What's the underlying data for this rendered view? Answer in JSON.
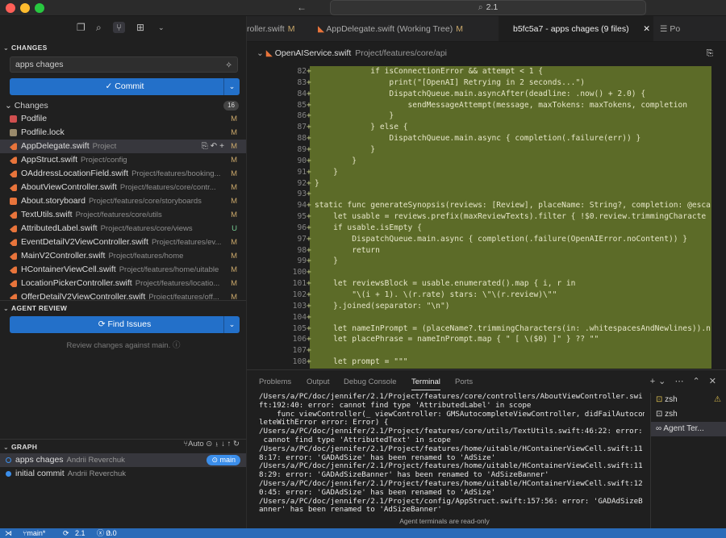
{
  "titlebar": {
    "search": "2.1"
  },
  "sidebar": {
    "changes_header": "CHANGES",
    "commit_message": "apps chages",
    "commit_label": "Commit",
    "changes_label": "Changes",
    "changes_count": "16",
    "files": [
      {
        "name": "Podfile",
        "path": "",
        "status": "M",
        "icon": "podfile-icon"
      },
      {
        "name": "Podfile.lock",
        "path": "",
        "status": "M",
        "icon": "lock-file-icon"
      },
      {
        "name": "AppDelegate.swift",
        "path": "Project",
        "status": "M",
        "icon": "swift-file-icon"
      },
      {
        "name": "AppStruct.swift",
        "path": "Project/config",
        "status": "M",
        "icon": "swift-file-icon"
      },
      {
        "name": "OAddressLocationField.swift",
        "path": "Project/features/booking...",
        "status": "M",
        "icon": "swift-file-icon"
      },
      {
        "name": "AboutViewController.swift",
        "path": "Project/features/core/contr...",
        "status": "M",
        "icon": "swift-file-icon"
      },
      {
        "name": "About.storyboard",
        "path": "Project/features/core/storyboards",
        "status": "M",
        "icon": "storyboard-icon"
      },
      {
        "name": "TextUtils.swift",
        "path": "Project/features/core/utils",
        "status": "M",
        "icon": "swift-file-icon"
      },
      {
        "name": "AttributedLabel.swift",
        "path": "Project/features/core/views",
        "status": "U",
        "icon": "swift-file-icon"
      },
      {
        "name": "EventDetailV2ViewController.swift",
        "path": "Project/features/ev...",
        "status": "M",
        "icon": "swift-file-icon"
      },
      {
        "name": "MainV2Controller.swift",
        "path": "Project/features/home",
        "status": "M",
        "icon": "swift-file-icon"
      },
      {
        "name": "HContainerViewCell.swift",
        "path": "Project/features/home/uitable",
        "status": "M",
        "icon": "swift-file-icon"
      },
      {
        "name": "LocationPickerController.swift",
        "path": "Project/features/locatio...",
        "status": "M",
        "icon": "swift-file-icon"
      },
      {
        "name": "OfferDetailV2ViewController.swift",
        "path": "Project/features/off...",
        "status": "M",
        "icon": "swift-file-icon"
      }
    ],
    "agent_review_header": "AGENT REVIEW",
    "find_issues_label": "Find Issues",
    "review_desc": "Review changes against main.",
    "graph_header": "GRAPH",
    "graph_auto": "Auto",
    "commits": [
      {
        "message": "apps chages",
        "author": "Andrii Reverchuk",
        "branch": "main"
      },
      {
        "message": "initial commit",
        "author": "Andrii Reverchuk",
        "branch": ""
      }
    ]
  },
  "tabs": [
    {
      "label": "roller.swift",
      "mark": "M"
    },
    {
      "label": "AppDelegate.swift (Working Tree)",
      "mark": "M"
    },
    {
      "label": "b5fc5a7 - apps chages (9 files)",
      "mark": ""
    },
    {
      "label": "Po",
      "mark": ""
    }
  ],
  "breadcrumb": {
    "file": "OpenAIService.swift",
    "path": "Project/features/core/api"
  },
  "code_lines": [
    {
      "n": "82",
      "t": "            if isConnectionError && attempt < 1 {"
    },
    {
      "n": "83",
      "t": "                print(\"[OpenAI] Retrying in 2 seconds...\")"
    },
    {
      "n": "84",
      "t": "                DispatchQueue.main.asyncAfter(deadline: .now() + 2.0) {"
    },
    {
      "n": "85",
      "t": "                    sendMessageAttempt(message, maxTokens: maxTokens, completion"
    },
    {
      "n": "86",
      "t": "                }"
    },
    {
      "n": "87",
      "t": "            } else {"
    },
    {
      "n": "88",
      "t": "                DispatchQueue.main.async { completion(.failure(err)) }"
    },
    {
      "n": "89",
      "t": "            }"
    },
    {
      "n": "90",
      "t": "        }"
    },
    {
      "n": "91",
      "t": "    }"
    },
    {
      "n": "92",
      "t": "}"
    },
    {
      "n": "93",
      "t": ""
    },
    {
      "n": "94",
      "t": "static func generateSynopsis(reviews: [Review], placeName: String?, completion: @esca"
    },
    {
      "n": "95",
      "t": "    let usable = reviews.prefix(maxReviewTexts).filter { !$0.review.trimmingCharacte"
    },
    {
      "n": "96",
      "t": "    if usable.isEmpty {"
    },
    {
      "n": "97",
      "t": "        DispatchQueue.main.async { completion(.failure(OpenAIError.noContent)) }"
    },
    {
      "n": "98",
      "t": "        return"
    },
    {
      "n": "99",
      "t": "    }"
    },
    {
      "n": "100",
      "t": ""
    },
    {
      "n": "101",
      "t": "    let reviewsBlock = usable.enumerated().map { i, r in"
    },
    {
      "n": "102",
      "t": "        \"\\(i + 1). \\(r.rate) stars: \\\"\\(r.review)\\\"\""
    },
    {
      "n": "103",
      "t": "    }.joined(separator: \"\\n\")"
    },
    {
      "n": "104",
      "t": ""
    },
    {
      "n": "105",
      "t": "    let nameInPrompt = (placeName?.trimmingCharacters(in: .whitespacesAndNewlines)).n"
    },
    {
      "n": "106",
      "t": "    let placePhrase = nameInPrompt.map { \" [ \\($0) ]\" } ?? \"\""
    },
    {
      "n": "107",
      "t": ""
    },
    {
      "n": "108",
      "t": "    let prompt = \"\"\""
    }
  ],
  "panel": {
    "tabs": [
      "Problems",
      "Output",
      "Debug Console",
      "Terminal",
      "Ports"
    ],
    "active_tab": "Terminal",
    "terminal_lines": [
      "/Users/a/PC/doc/jennifer/2.1/Project/features/core/controllers/AboutViewController.swi",
      "ft:192:40: error: cannot find type 'AttributedLabel' in scope",
      "    func viewController(_ viewController: GMSAutocompleteViewController, didFailAutocomp",
      "leteWithError error: Error) {",
      "/Users/a/PC/doc/jennifer/2.1/Project/features/core/utils/TextUtils.swift:46:22: error:",
      " cannot find type 'AttributedText' in scope",
      "/Users/a/PC/doc/jennifer/2.1/Project/features/home/uitable/HContainerViewCell.swift:11",
      "8:17: error: 'GADAdSize' has been renamed to 'AdSize'",
      "/Users/a/PC/doc/jennifer/2.1/Project/features/home/uitable/HContainerViewCell.swift:11",
      "8:29: error: 'GADAdSizeBanner' has been renamed to 'AdSizeBanner'",
      "/Users/a/PC/doc/jennifer/2.1/Project/features/home/uitable/HContainerViewCell.swift:12",
      "0:45: error: 'GADAdSize' has been renamed to 'AdSize'",
      "/Users/a/PC/doc/jennifer/2.1/Project/config/AppStruct.swift:157:56: error: 'GADAdSizeB",
      "anner' has been renamed to 'AdSizeBanner'"
    ],
    "terminal_note": "Agent terminals are read-only",
    "terminals": [
      {
        "label": "zsh",
        "warn": true
      },
      {
        "label": "zsh",
        "warn": false
      },
      {
        "label": "Agent Ter...",
        "warn": false
      }
    ]
  },
  "status": {
    "branch": "main*",
    "version": "2.1",
    "errors": "0",
    "warnings": "0"
  }
}
